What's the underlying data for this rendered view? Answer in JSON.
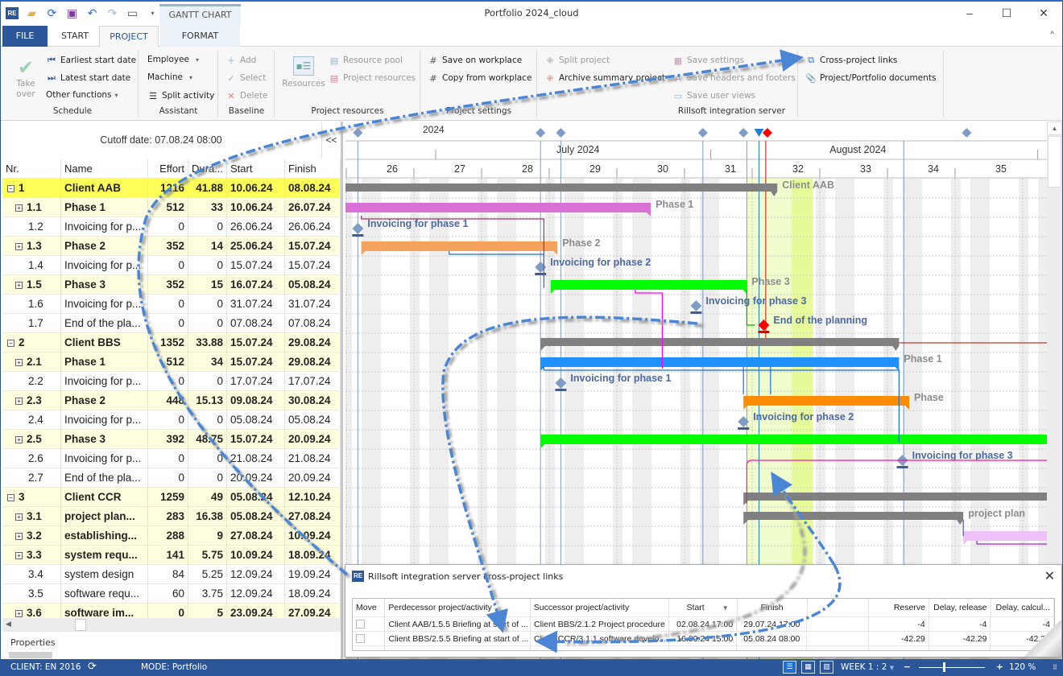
{
  "window": {
    "title": "Portfolio 2024_cloud",
    "context_tab": "GANTT CHART",
    "controls": {
      "minimize": "–",
      "maximize": "☐",
      "close": "✕"
    }
  },
  "quick_access": [
    "app-logo",
    "open-folder",
    "refresh",
    "save",
    "undo",
    "redo",
    "window",
    "customize"
  ],
  "tabs": {
    "file": "FILE",
    "start": "START",
    "project": "PROJECT",
    "format": "FORMAT",
    "active": "PROJECT"
  },
  "ribbon": {
    "schedule": {
      "label": "Schedule",
      "take_over": "Take over",
      "earliest": "Earliest start date",
      "latest": "Latest start date",
      "other": "Other functions"
    },
    "assistant": {
      "label": "Assistant",
      "employee": "Employee",
      "machine": "Machine",
      "split": "Split activity"
    },
    "baseline": {
      "label": "Baseline",
      "add": "Add",
      "select": "Select",
      "delete": "Delete"
    },
    "project_resources": {
      "label": "Project resources",
      "resources": "Resources",
      "pool": "Resource pool",
      "project_resources": "Project resources"
    },
    "project_settings": {
      "label": "Project settings",
      "save_wp": "Save on workplace",
      "copy_wp": "Copy from workplace"
    },
    "split_group": {
      "split_project": "Split project",
      "archive": "Archive summary project"
    },
    "integration": {
      "label": "Rillsoft integration server",
      "save_settings": "Save settings",
      "save_headers": "Save headers and footers",
      "save_views": "Save user views"
    },
    "links": {
      "cross": "Cross-project links",
      "docs": "Project/Portfolio documents"
    }
  },
  "left_pane": {
    "cutoff": "Cutoff date: 07.08.24 08:00",
    "collapse": "<<",
    "columns": [
      "Nr.",
      "Name",
      "Effort",
      "Dura...",
      "Start",
      "Finish"
    ],
    "rows": [
      {
        "nr": "1",
        "name": "Client AAB",
        "effort": "1216",
        "dur": "41.88",
        "start": "10.06.24",
        "finish": "08.08.24",
        "level": 0,
        "style": "y1",
        "exp": "−"
      },
      {
        "nr": "1.1",
        "name": "Phase 1",
        "effort": "512",
        "dur": "33",
        "start": "10.06.24",
        "finish": "26.07.24",
        "level": 1,
        "style": "y2",
        "exp": "+"
      },
      {
        "nr": "1.2",
        "name": "Invoicing for p...",
        "effort": "0",
        "dur": "0",
        "start": "26.06.24",
        "finish": "26.06.24",
        "level": 2,
        "style": "w"
      },
      {
        "nr": "1.3",
        "name": "Phase 2",
        "effort": "352",
        "dur": "14",
        "start": "25.06.24",
        "finish": "15.07.24",
        "level": 1,
        "style": "y2",
        "exp": "+"
      },
      {
        "nr": "1.4",
        "name": "Invoicing for p...",
        "effort": "0",
        "dur": "0",
        "start": "15.07.24",
        "finish": "15.07.24",
        "level": 2,
        "style": "w"
      },
      {
        "nr": "1.5",
        "name": "Phase 3",
        "effort": "352",
        "dur": "15",
        "start": "16.07.24",
        "finish": "05.08.24",
        "level": 1,
        "style": "y2",
        "exp": "+"
      },
      {
        "nr": "1.6",
        "name": "Invoicing for p...",
        "effort": "0",
        "dur": "0",
        "start": "31.07.24",
        "finish": "31.07.24",
        "level": 2,
        "style": "w"
      },
      {
        "nr": "1.7",
        "name": "End of the pla...",
        "effort": "0",
        "dur": "0",
        "start": "07.08.24",
        "finish": "07.08.24",
        "level": 2,
        "style": "w"
      },
      {
        "nr": "2",
        "name": "Client BBS",
        "effort": "1352",
        "dur": "33.88",
        "start": "15.07.24",
        "finish": "29.08.24",
        "level": 0,
        "style": "y2",
        "exp": "−"
      },
      {
        "nr": "2.1",
        "name": "Phase 1",
        "effort": "512",
        "dur": "34",
        "start": "15.07.24",
        "finish": "29.08.24",
        "level": 1,
        "style": "y2",
        "exp": "+"
      },
      {
        "nr": "2.2",
        "name": "Invoicing for p...",
        "effort": "0",
        "dur": "0",
        "start": "17.07.24",
        "finish": "17.07.24",
        "level": 2,
        "style": "w"
      },
      {
        "nr": "2.3",
        "name": "Phase 2",
        "effort": "448",
        "dur": "15.13",
        "start": "09.08.24",
        "finish": "30.08.24",
        "level": 1,
        "style": "y2",
        "exp": "+"
      },
      {
        "nr": "2.4",
        "name": "Invoicing for p...",
        "effort": "0",
        "dur": "0",
        "start": "05.08.24",
        "finish": "05.08.24",
        "level": 2,
        "style": "w"
      },
      {
        "nr": "2.5",
        "name": "Phase 3",
        "effort": "392",
        "dur": "48.75",
        "start": "15.07.24",
        "finish": "20.09.24",
        "level": 1,
        "style": "y2",
        "exp": "+"
      },
      {
        "nr": "2.6",
        "name": "Invoicing for p...",
        "effort": "0",
        "dur": "0",
        "start": "21.08.24",
        "finish": "21.08.24",
        "level": 2,
        "style": "w"
      },
      {
        "nr": "2.7",
        "name": "End of the pla...",
        "effort": "0",
        "dur": "0",
        "start": "20.09.24",
        "finish": "20.09.24",
        "level": 2,
        "style": "w"
      },
      {
        "nr": "3",
        "name": "Client CCR",
        "effort": "1259",
        "dur": "49",
        "start": "05.08.24",
        "finish": "12.10.24",
        "level": 0,
        "style": "y2",
        "exp": "−"
      },
      {
        "nr": "3.1",
        "name": "project plan...",
        "effort": "283",
        "dur": "16.38",
        "start": "05.08.24",
        "finish": "27.08.24",
        "level": 1,
        "style": "y2",
        "exp": "+"
      },
      {
        "nr": "3.2",
        "name": "establishing...",
        "effort": "288",
        "dur": "9",
        "start": "27.08.24",
        "finish": "10.09.24",
        "level": 1,
        "style": "y2",
        "exp": "+"
      },
      {
        "nr": "3.3",
        "name": "system requ...",
        "effort": "141",
        "dur": "5.75",
        "start": "10.09.24",
        "finish": "18.09.24",
        "level": 1,
        "style": "y2",
        "exp": "+"
      },
      {
        "nr": "3.4",
        "name": "system design",
        "effort": "84",
        "dur": "5.25",
        "start": "12.09.24",
        "finish": "19.09.24",
        "level": 2,
        "style": "w"
      },
      {
        "nr": "3.5",
        "name": "software requ...",
        "effort": "60",
        "dur": "3.75",
        "start": "12.09.24",
        "finish": "18.09.24",
        "level": 2,
        "style": "w"
      },
      {
        "nr": "3.6",
        "name": "software im...",
        "effort": "0",
        "dur": "5",
        "start": "23.09.24",
        "finish": "27.09.24",
        "level": 1,
        "style": "y2",
        "exp": "+"
      }
    ],
    "properties": "Properties"
  },
  "gantt": {
    "year": "2024",
    "months": [
      {
        "label": "July 2024",
        "week": 29
      },
      {
        "label": "August 2024",
        "week": 33.3
      }
    ],
    "weeks": [
      "26",
      "27",
      "28",
      "29",
      "30",
      "31",
      "32",
      "33",
      "34",
      "35"
    ],
    "bars": [
      {
        "row": 0,
        "label": "Client AAB",
        "from": 25.5,
        "to": 32.05,
        "color": "#808080",
        "type": "summary"
      },
      {
        "row": 1,
        "label": "Phase 1",
        "from": 25.5,
        "to": 30.18,
        "color": "#da6fd6",
        "type": "task"
      },
      {
        "row": 2,
        "label": "Invoicing for phase 1",
        "at": 25.85,
        "type": "milestone"
      },
      {
        "row": 3,
        "label": "Phase 2",
        "from": 25.9,
        "to": 28.8,
        "color": "#f5a25d",
        "type": "task"
      },
      {
        "row": 4,
        "label": "Invoicing for phase 2",
        "at": 28.55,
        "type": "milestone"
      },
      {
        "row": 5,
        "label": "Phase 3",
        "from": 28.7,
        "to": 31.6,
        "color": "#00ff00",
        "type": "task"
      },
      {
        "row": 6,
        "label": "Invoicing for phase 3",
        "at": 30.85,
        "type": "milestone"
      },
      {
        "row": 7,
        "label": "End of the planning",
        "at": 31.85,
        "type": "milestone-red"
      },
      {
        "row": 8,
        "label": "",
        "from": 28.55,
        "to": 33.85,
        "color": "#808080",
        "type": "summary"
      },
      {
        "row": 9,
        "label": "Phase 1",
        "from": 28.55,
        "to": 33.85,
        "color": "#1e90ff",
        "type": "task"
      },
      {
        "row": 10,
        "label": "Invoicing for phase 1",
        "at": 28.85,
        "type": "milestone"
      },
      {
        "row": 11,
        "label": "Phase",
        "from": 31.55,
        "to": 34.0,
        "color": "#ff8c00",
        "type": "task"
      },
      {
        "row": 12,
        "label": "Invoicing for phase 2",
        "at": 31.55,
        "type": "milestone"
      },
      {
        "row": 13,
        "label": "",
        "from": 28.55,
        "to": 36.5,
        "color": "#00ff00",
        "type": "task"
      },
      {
        "row": 14,
        "label": "Invoicing for phase 3",
        "at": 33.9,
        "type": "milestone"
      },
      {
        "row": 16,
        "label": "",
        "from": 31.55,
        "to": 36.5,
        "color": "#808080",
        "type": "summary"
      },
      {
        "row": 17,
        "label": "project plan",
        "from": 31.55,
        "to": 34.8,
        "color": "#808080",
        "type": "summary"
      },
      {
        "row": 18,
        "label": "",
        "from": 34.8,
        "to": 36.5,
        "color": "#f0c0f8",
        "type": "task"
      }
    ],
    "top_diamonds": [
      25.85,
      28.55,
      28.85,
      30.95,
      31.55,
      34.85
    ],
    "today_marker": 31.78,
    "red_marker": 31.88
  },
  "dialog": {
    "title": "Rillsoft integration server cross-project links",
    "columns": [
      "Move",
      "Perdecessor project/activity",
      "Successor project/activity",
      "Start",
      "Finish",
      "",
      "Reserve",
      "Delay, release",
      "Delay, calcul..."
    ],
    "rows": [
      {
        "pre": "Client AAB/1.5.5 Briefing at start of ...",
        "suc": "Client BBS/2.1.2 Project procedure",
        "start": "02.08.24 17:00",
        "finish": "29.07.24 17:00",
        "reserve": "-4",
        "delay_rel": "-4",
        "delay_calc": "-4"
      },
      {
        "pre": "Client BBS/2.5.5 Briefing at start of ...",
        "suc": "Client CCR/3.1.1 software develo...",
        "start": "16.09.24 15:00",
        "finish": "05.08.24 08:00",
        "reserve": "-42.29",
        "delay_rel": "-42.29",
        "delay_calc": "-42.29"
      }
    ]
  },
  "status": {
    "client": "CLIENT: EN 2016",
    "mode": "MODE: Portfolio",
    "week": "WEEK 1 : 2",
    "zoom": "120 %",
    "zoom_level": 0.37
  }
}
